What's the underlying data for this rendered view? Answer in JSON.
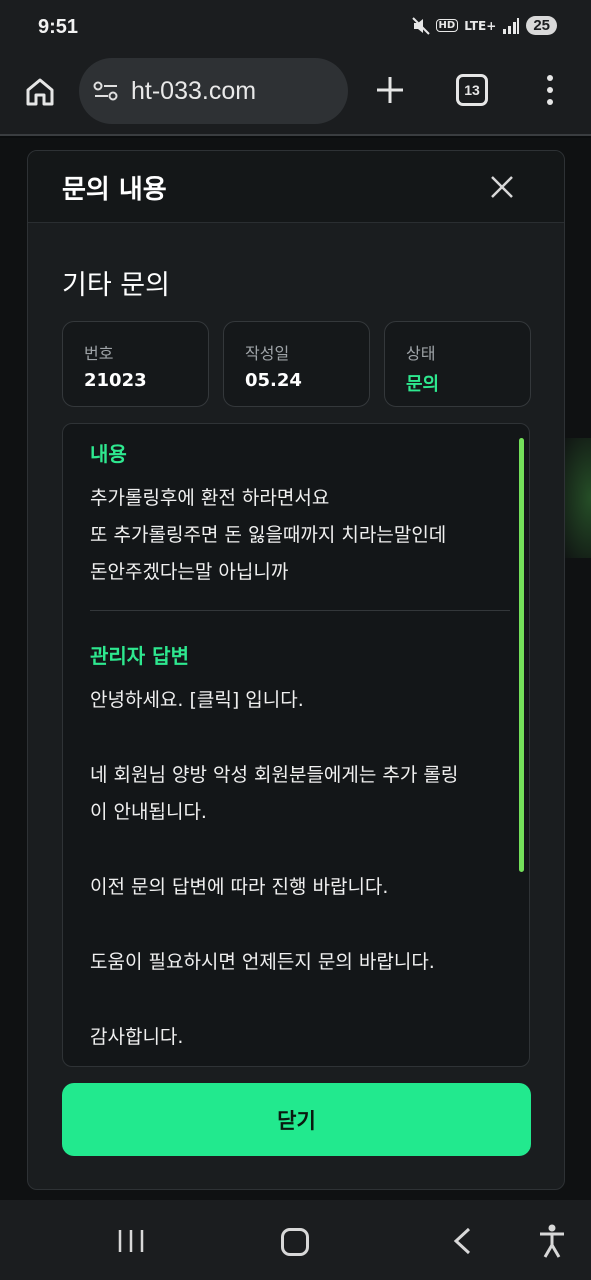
{
  "status_bar": {
    "time": "9:51",
    "network": "LTE+",
    "hd": "HD",
    "battery": "25"
  },
  "browser": {
    "url": "ht-033.com",
    "tab_count": "13"
  },
  "modal": {
    "title": "문의 내용",
    "inquiry_type": "기타 문의",
    "info": [
      {
        "label": "번호",
        "value": "21023"
      },
      {
        "label": "작성일",
        "value": "05.24"
      },
      {
        "label": "상태",
        "value": "문의"
      }
    ],
    "content_title": "내용",
    "content_lines": [
      "추가롤링후에 환전 하라면서요",
      "또 추가롤링주면 돈 잃을때까지 치라는말인데",
      "돈안주겠다는말 아닙니까"
    ],
    "answer_title": "관리자 답변",
    "answer_lines": [
      "안녕하세요. [클릭] 입니다.",
      "",
      "네 회원님 양방 악성 회원분들에게는 추가 롤링",
      "이 안내됩니다.",
      "",
      "이전 문의 답변에 따라 진행 바랍니다.",
      "",
      "도움이 필요하시면 언제든지 문의 바랍니다.",
      "",
      "감사합니다."
    ],
    "close_button": "닫기"
  },
  "colors": {
    "accent": "#22e98e",
    "status_green": "#2ee88f",
    "scrollbar": "#74e05a"
  }
}
